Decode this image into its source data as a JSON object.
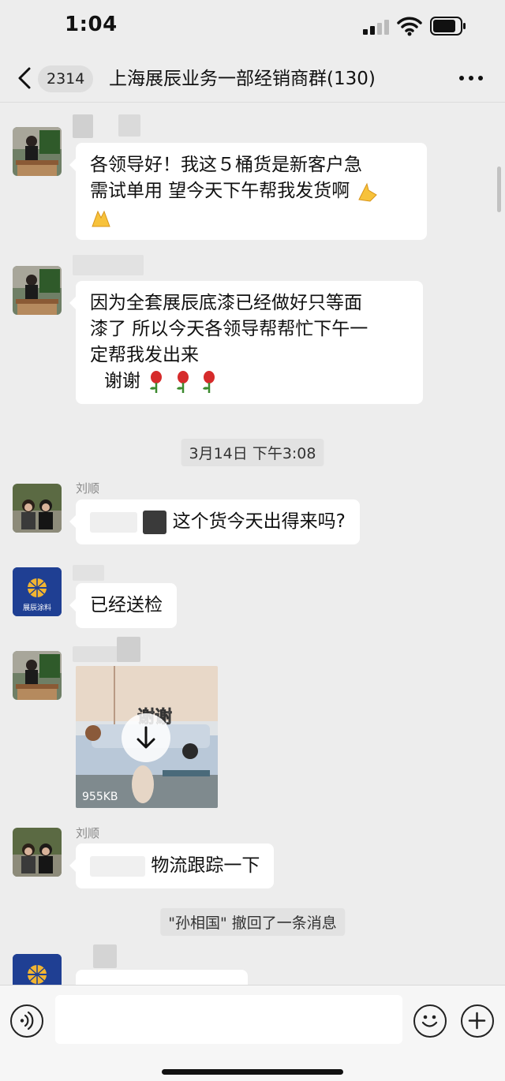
{
  "status_bar": {
    "time": "1:04"
  },
  "nav": {
    "unread_count": "2314",
    "title": "上海展辰业务一部经销商群(130)"
  },
  "messages": [
    {
      "type": "text",
      "lines": [
        "各领导好！我这５桶货是新客户急",
        "需试单用  望今天下午帮我发货啊"
      ],
      "emoji": "pray-emoji"
    },
    {
      "type": "text",
      "lines": [
        "因为全套展辰底漆已经做好只等面",
        "漆了  所以今天各领导帮帮忙下午一",
        "定帮我发出来"
      ],
      "thanks": "谢谢",
      "emoji": "rose-emoji"
    },
    {
      "type": "timestamp",
      "text": "3月14日 下午3:08"
    },
    {
      "type": "text",
      "sender": "刘顺",
      "text": "这个货今天出得来吗?"
    },
    {
      "type": "text",
      "text": "已经送检",
      "avatar_logo_text": "展辰涂料"
    },
    {
      "type": "video",
      "size": "955KB",
      "overlay_text": "谢谢"
    },
    {
      "type": "text",
      "sender": "刘顺",
      "text": "物流跟踪一下"
    },
    {
      "type": "system",
      "text": "\"孙相国\" 撤回了一条消息"
    }
  ],
  "input": {
    "placeholder": ""
  },
  "colors": {
    "background": "#ededed",
    "bubble": "#ffffff",
    "logo_blue": "#1f3f93",
    "logo_gold": "#f2b531"
  }
}
